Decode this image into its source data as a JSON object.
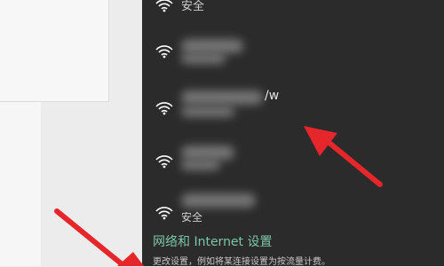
{
  "networks": {
    "top_item_label": "安全",
    "item2_suffix": "/w",
    "item5_label": "安全"
  },
  "settings": {
    "link_text": "网络和 Internet 设置",
    "description": "更改设置，例如将某连接设置为按流量计费。"
  },
  "colors": {
    "flyout_bg": "#2b2b2b",
    "accent_link": "#7cc6a8",
    "annotation_arrow": "#e5262a"
  },
  "icons": [
    "wifi-icon"
  ]
}
